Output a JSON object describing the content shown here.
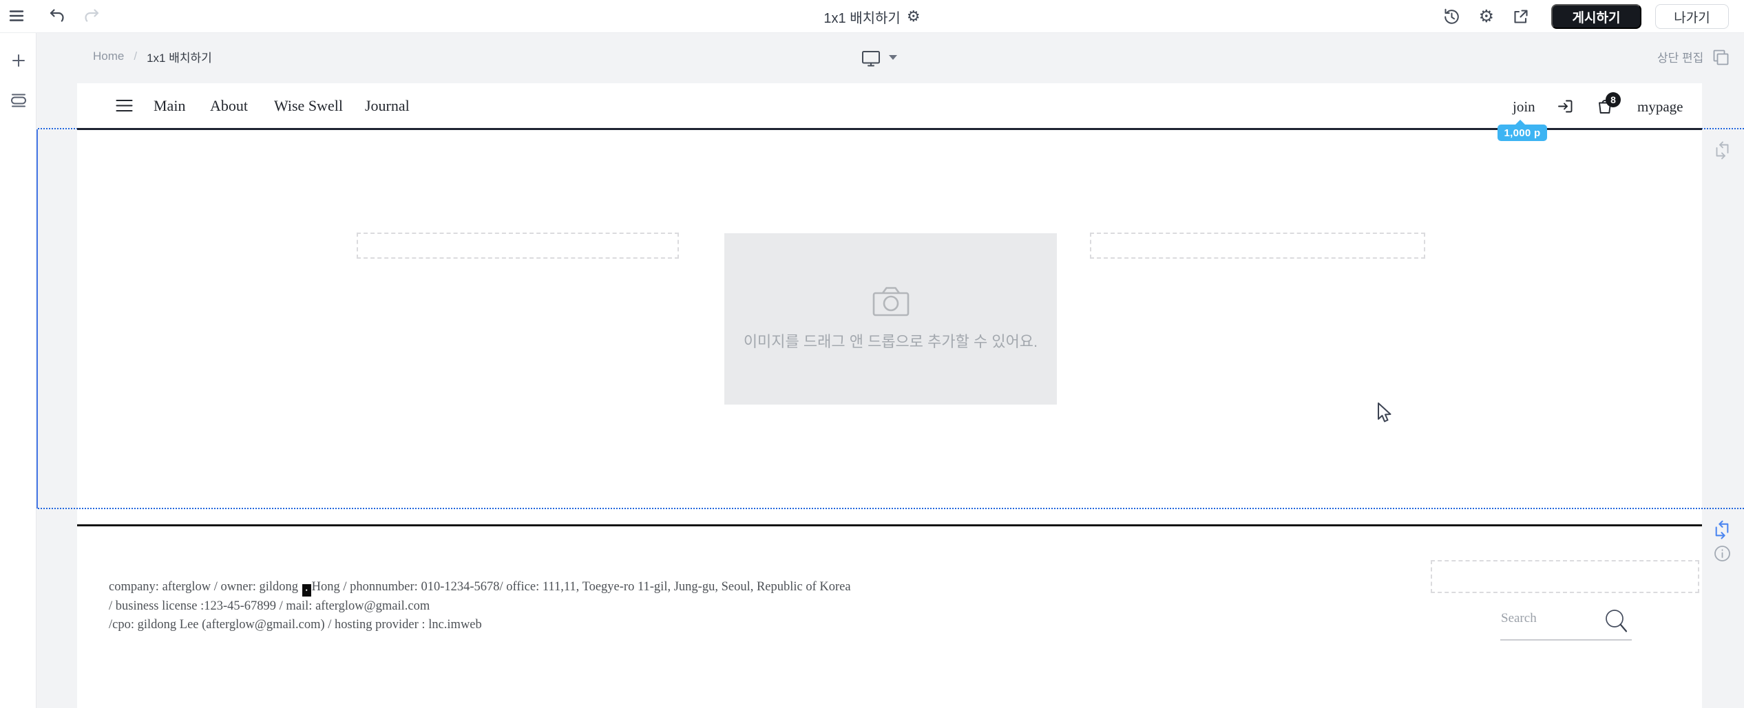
{
  "topbar": {
    "title": "1x1 배치하기",
    "publish_label": "게시하기",
    "exit_label": "나가기"
  },
  "breadcrumb": {
    "home": "Home",
    "separator": "/",
    "current": "1x1 배치하기",
    "edit_top_label": "상단 편집"
  },
  "site": {
    "nav": {
      "items": [
        "Main",
        "About",
        "Wise Swell",
        "Journal"
      ]
    },
    "user_menu": {
      "join": "join",
      "mypage": "mypage",
      "cart_badge_count": "8",
      "points_tooltip": "1,000 p"
    },
    "dropzone": {
      "text": "이미지를 드래그 앤 드롭으로 추가할 수 있어요."
    },
    "footer": {
      "line1_before": "company: afterglow / owner: gildong ",
      "caret_glyph": "•",
      "line1_after": "Hong / phonnumber: 010-1234-5678/ office: 111,11, Toegye-ro 11-gil, Jung-gu, Seoul, Republic of Korea",
      "line2": "/ business license :123-45-67899 / mail: afterglow@gmail.com",
      "line3": "/cpo: gildong Lee (afterglow@gmail.com) / hosting provider : lnc.imweb",
      "search_placeholder": "Search"
    }
  },
  "colors": {
    "guide_blue": "#2166dd",
    "points_badge_blue": "#3db4f3",
    "publish_button_bg": "#16191f",
    "site_border_navy": "#1e2332"
  }
}
